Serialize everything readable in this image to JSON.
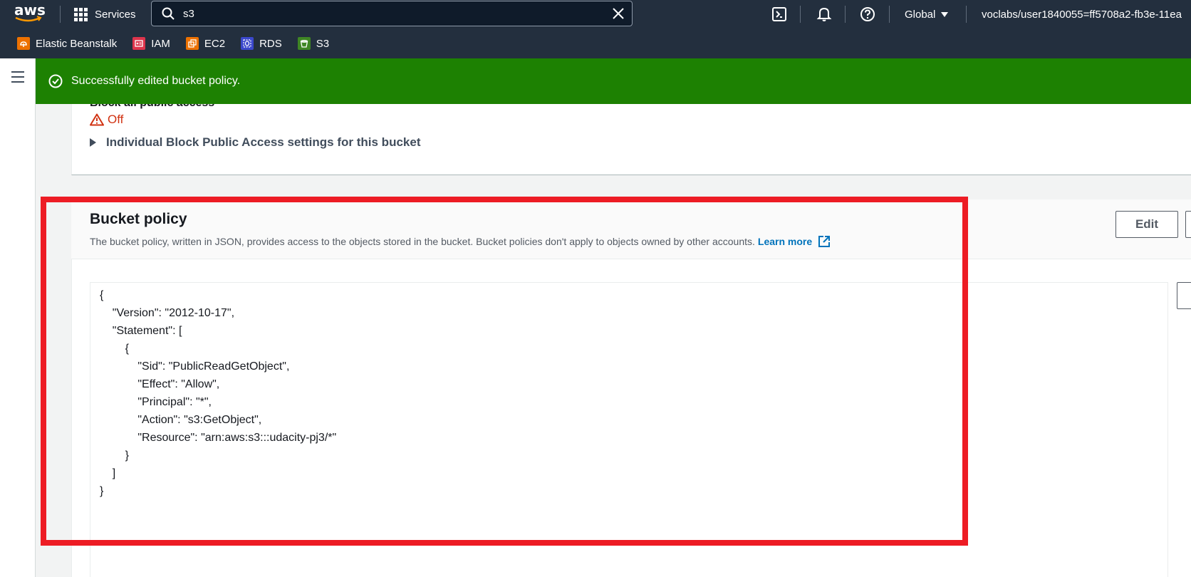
{
  "topbar": {
    "logo_text": "aws",
    "services_label": "Services",
    "search_value": "s3",
    "region_label": "Global",
    "user_label": "voclabs/user1840055=ff5708a2-fb3e-11ea"
  },
  "favorites": [
    {
      "label": "Elastic Beanstalk",
      "color": "#ed7100"
    },
    {
      "label": "IAM",
      "color": "#dd344c"
    },
    {
      "label": "EC2",
      "color": "#ed7100"
    },
    {
      "label": "RDS",
      "color": "#3b48cc"
    },
    {
      "label": "S3",
      "color": "#3f8624"
    }
  ],
  "flash": {
    "message": "Successfully edited bucket policy.",
    "color": "#1d8102"
  },
  "block_public_access": {
    "title": "Block all public access",
    "status": "Off",
    "expand_label": "Individual Block Public Access settings for this bucket"
  },
  "bucket_policy": {
    "title": "Bucket policy",
    "description": "The bucket policy, written in JSON, provides access to the objects stored in the bucket. Bucket policies don't apply to objects owned by other accounts.",
    "learn_more": "Learn more",
    "edit_label": "Edit",
    "code": "{\n    \"Version\": \"2012-10-17\",\n    \"Statement\": [\n        {\n            \"Sid\": \"PublicReadGetObject\",\n            \"Effect\": \"Allow\",\n            \"Principal\": \"*\",\n            \"Action\": \"s3:GetObject\",\n            \"Resource\": \"arn:aws:s3:::udacity-pj3/*\"\n        }\n    ]\n}"
  },
  "annotation_color": "#ed1c24"
}
